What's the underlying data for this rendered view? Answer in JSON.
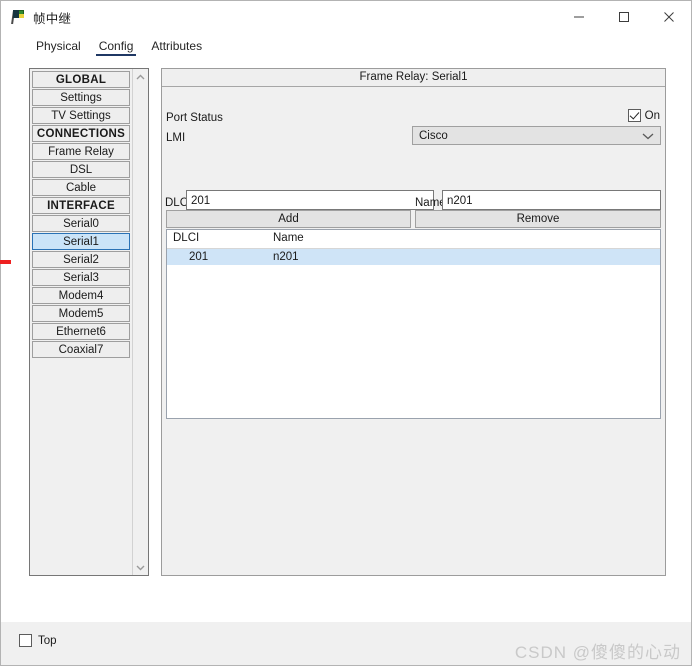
{
  "window": {
    "title": "帧中继",
    "icon": "frame-relay-flag-icon",
    "controls": {
      "minimize": "minimize-icon",
      "maximize": "maximize-icon",
      "close": "close-icon"
    }
  },
  "tabs": [
    {
      "label": "Physical",
      "active": false
    },
    {
      "label": "Config",
      "active": true
    },
    {
      "label": "Attributes",
      "active": false
    }
  ],
  "sidebar": {
    "items": [
      {
        "label": "GLOBAL",
        "type": "header"
      },
      {
        "label": "Settings",
        "type": "item"
      },
      {
        "label": "TV Settings",
        "type": "item"
      },
      {
        "label": "CONNECTIONS",
        "type": "header"
      },
      {
        "label": "Frame Relay",
        "type": "item"
      },
      {
        "label": "DSL",
        "type": "item"
      },
      {
        "label": "Cable",
        "type": "item"
      },
      {
        "label": "INTERFACE",
        "type": "header"
      },
      {
        "label": "Serial0",
        "type": "item"
      },
      {
        "label": "Serial1",
        "type": "item",
        "selected": true
      },
      {
        "label": "Serial2",
        "type": "item"
      },
      {
        "label": "Serial3",
        "type": "item"
      },
      {
        "label": "Modem4",
        "type": "item"
      },
      {
        "label": "Modem5",
        "type": "item"
      },
      {
        "label": "Ethernet6",
        "type": "item"
      },
      {
        "label": "Coaxial7",
        "type": "item"
      }
    ],
    "scrollbar": {
      "up_icon": "chevron-up-icon",
      "down_icon": "chevron-down-icon"
    }
  },
  "panel": {
    "title": "Frame Relay: Serial1",
    "port_status_label": "Port Status",
    "port_status_on_label": "On",
    "port_status_on_checked": true,
    "lmi_label": "LMI",
    "lmi_value": "Cisco",
    "lmi_chevron": "chevron-down-icon",
    "dlci_label": "DLCI",
    "dlci_value": "201",
    "name_label": "Name",
    "name_value": "n201",
    "add_label": "Add",
    "remove_label": "Remove",
    "table": {
      "columns": [
        "DLCI",
        "Name"
      ],
      "rows": [
        {
          "dlci": "201",
          "name": "n201",
          "selected": true
        }
      ]
    }
  },
  "footer": {
    "top_label": "Top",
    "top_checked": false,
    "watermark": "CSDN @傻傻的心动"
  },
  "colors": {
    "tab_active_underline": "#1f3864",
    "selection_blue": "#cbe4f8",
    "selection_border": "#2a72b5",
    "panel_bg": "#f0f0f0",
    "marker_red": "#ee2020"
  }
}
